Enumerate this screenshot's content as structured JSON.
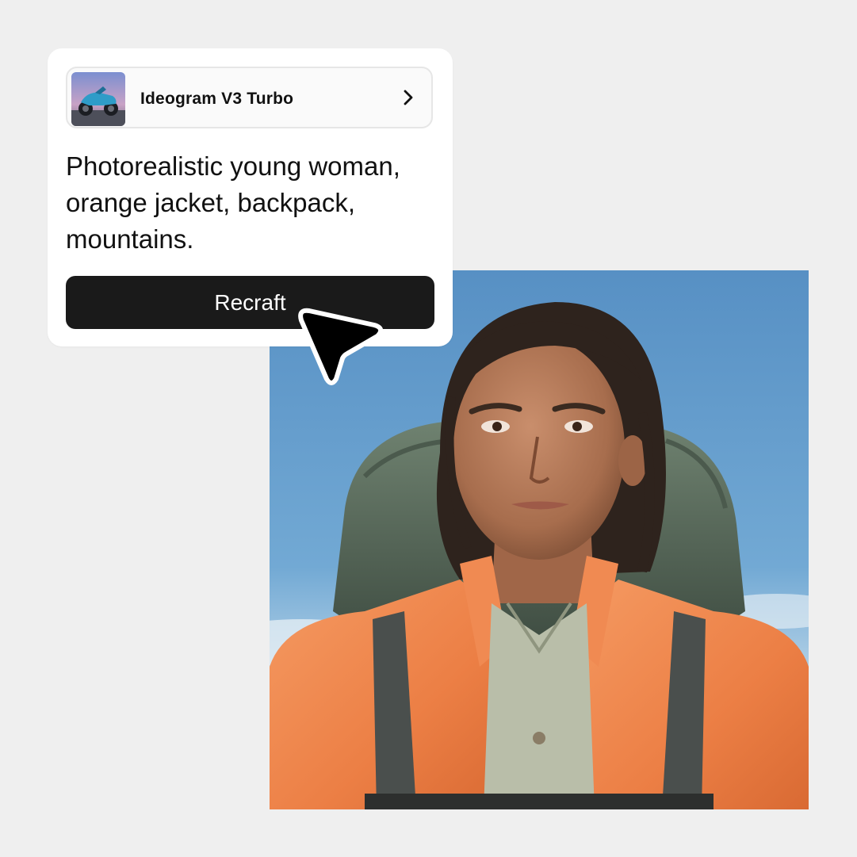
{
  "model_selector": {
    "name": "Ideogram V3 Turbo",
    "thumbnail_icon": "motorcycle-thumbnail",
    "chevron_icon": "chevron-right-icon"
  },
  "prompt": {
    "text": "Photorealistic young woman,\norange jacket, backpack,\nmountains."
  },
  "action": {
    "button_label": "Recraft"
  },
  "cursor_icon": "arrow-cursor-icon",
  "colors": {
    "background": "#efefef",
    "card": "#ffffff",
    "button": "#1a1a1a",
    "button_text": "#ffffff",
    "sky": "#6aa4d2",
    "jacket": "#f2854d",
    "backpack": "#5d6f5d"
  }
}
